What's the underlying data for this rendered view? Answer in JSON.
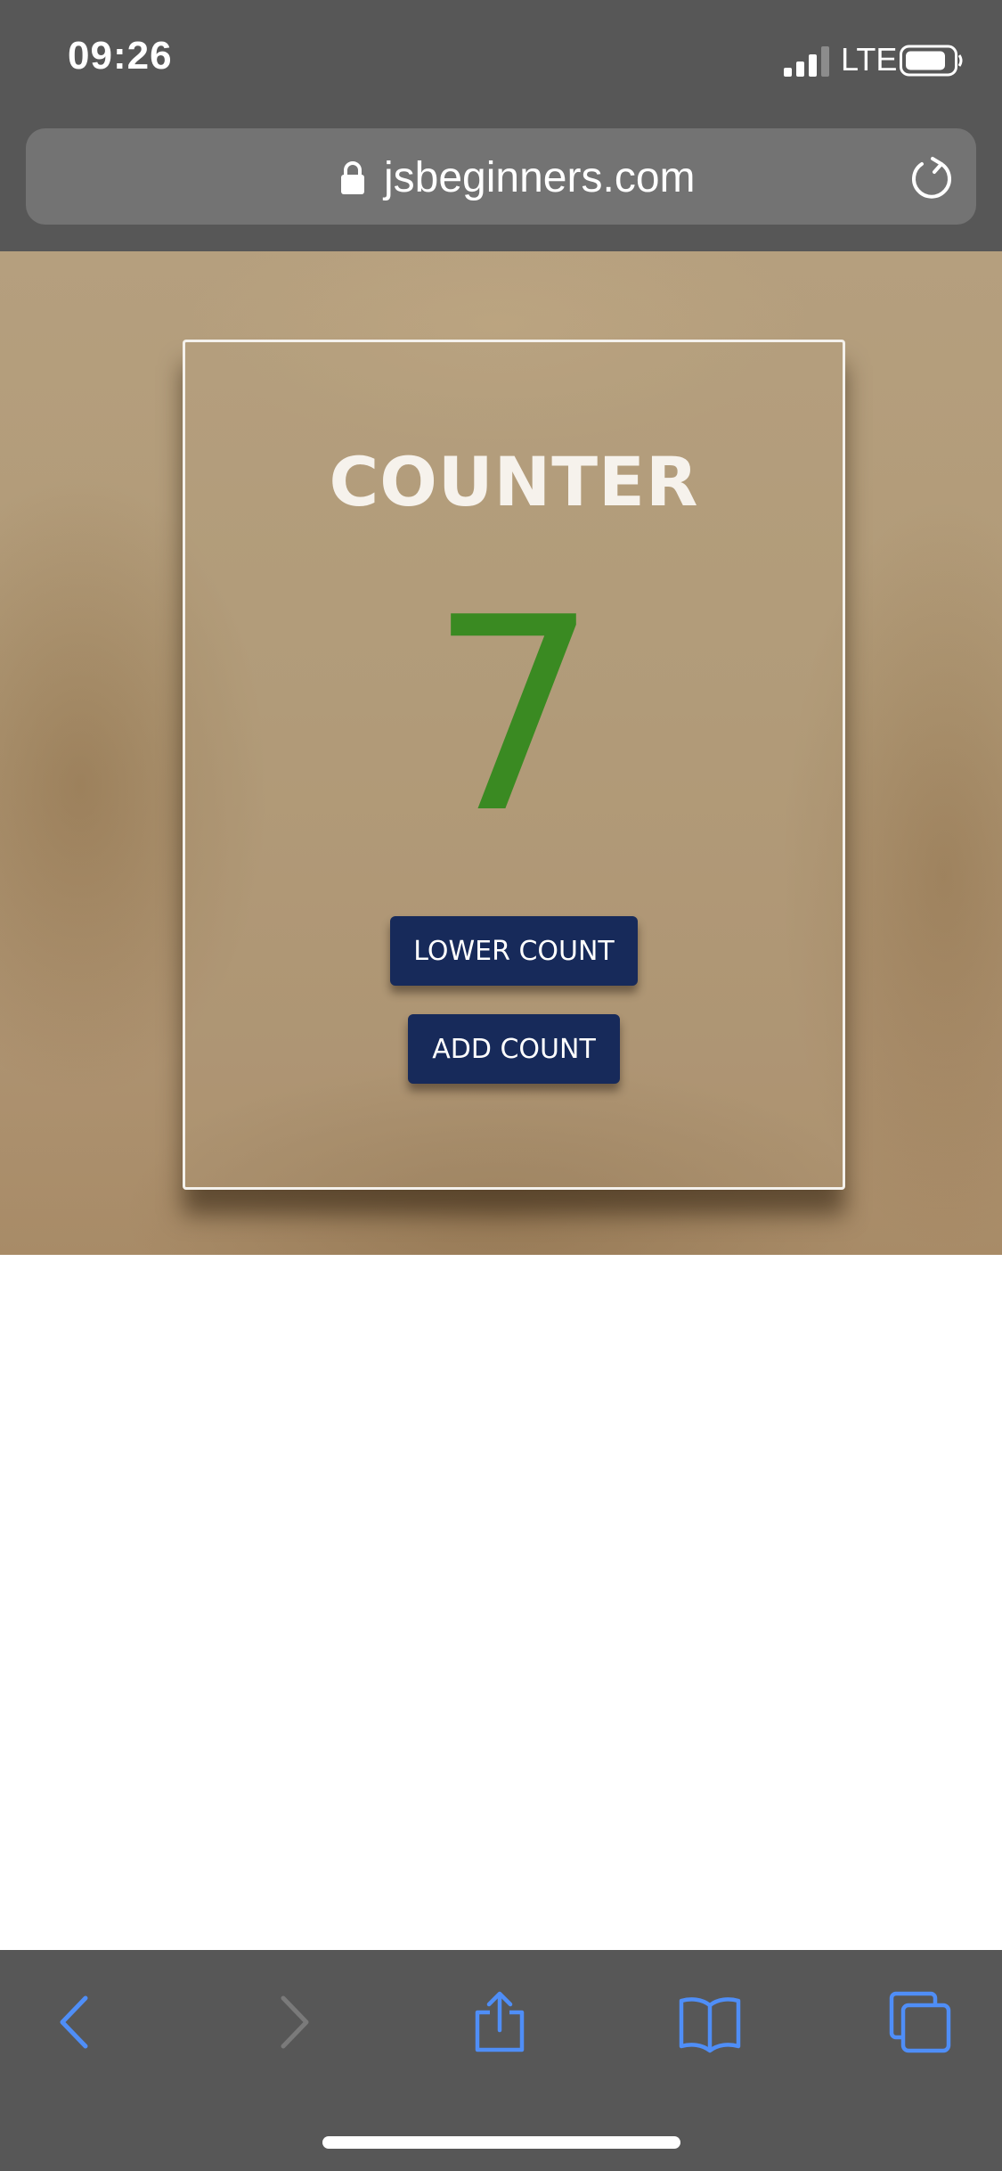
{
  "status_bar": {
    "time": "09:26",
    "network": "LTE",
    "icons": [
      "signal-icon",
      "battery-icon"
    ]
  },
  "browser": {
    "url": "jsbeginners.com",
    "icons": [
      "lock-icon",
      "reload-icon"
    ]
  },
  "counter": {
    "title": "COUNTER",
    "value": "7",
    "value_color": "#3a8a22",
    "lower_label": "LOWER COUNT",
    "add_label": "ADD COUNT",
    "button_color": "#172a5a"
  },
  "toolbar": {
    "icons": [
      "back-icon",
      "forward-icon",
      "share-icon",
      "bookmarks-icon",
      "tabs-icon"
    ],
    "accent": "#4f8ef7"
  }
}
